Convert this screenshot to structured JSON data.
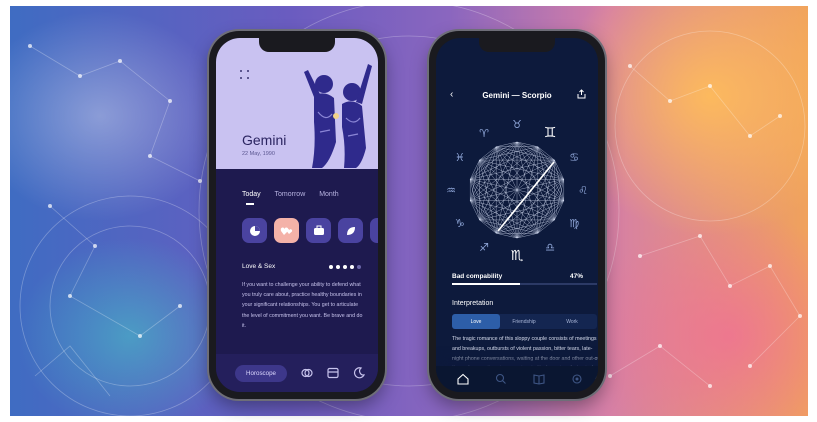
{
  "phone_left": {
    "sign_name": "Gemini",
    "birth_date": "22 May, 1990",
    "tabs": [
      {
        "label": "Today",
        "active": true
      },
      {
        "label": "Tomorrow",
        "active": false
      },
      {
        "label": "Month",
        "active": false
      }
    ],
    "categories": [
      {
        "icon": "pie-chart-icon",
        "active": false
      },
      {
        "icon": "hearts-icon",
        "active": true
      },
      {
        "icon": "briefcase-icon",
        "active": false
      },
      {
        "icon": "leaf-icon",
        "active": false
      },
      {
        "icon": "palette-icon",
        "active": false
      }
    ],
    "section_title": "Love & Sex",
    "rating": {
      "filled": 4,
      "total": 5
    },
    "body_text": "If you want to challenge your ability to defend what you truly care about, practice healthy boundaries in your significant relationships. You get to articulate the level of commitment you want. Be brave and do it.",
    "nav": {
      "horoscope_label": "Horoscope",
      "icons": [
        "rings-icon",
        "card-icon",
        "moon-icon"
      ]
    },
    "colors": {
      "screen_bg": "#1e1a4f",
      "header_bg": "#c9c2f1",
      "accent": "#f4b2a8"
    }
  },
  "phone_right": {
    "title": "Gemini — Scorpio",
    "zodiac_signs": [
      "♈",
      "♉",
      "♊",
      "♋",
      "♌",
      "♍",
      "♎",
      "♏",
      "♐",
      "♑",
      "♒",
      "♓"
    ],
    "highlighted_signs": [
      "♊",
      "♏"
    ],
    "compatibility": {
      "label": "Bad compability",
      "value_text": "47%",
      "value": 47
    },
    "interpretation_title": "Interpretation",
    "segments": [
      {
        "label": "Love",
        "active": true
      },
      {
        "label": "Friendship",
        "active": false
      },
      {
        "label": "Work",
        "active": false
      }
    ],
    "body_text": "The tragic romance of this sloppy couple consists of meetings and breakups, outbursts of violent passion, bitter tears, late-night phone conversations, waiting at the door and other out-of-the-ordinary actions in a passionate fit of passion. A physical connection and spiritual connection between Gemini — Scorpio is likely, but a long-term relationship will include",
    "nav_icons": [
      "home-icon",
      "search-icon",
      "book-icon",
      "settings-icon"
    ],
    "colors": {
      "screen_bg": "#0d1a3c",
      "segment_active": "#2d5ea8"
    }
  }
}
